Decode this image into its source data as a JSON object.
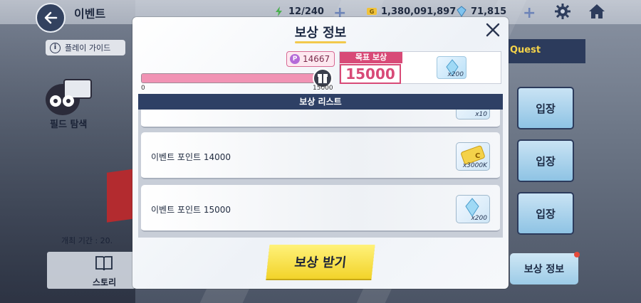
{
  "header": {
    "title": "이벤트",
    "stamina": "12/240",
    "gold": "1,380,091,897",
    "gems": "71,815"
  },
  "left_panel": {
    "guide_label": "플레이 가이드",
    "field_label": "필드 탐색",
    "period_label": "개최 기간 : 20.",
    "story_label": "스토리"
  },
  "right_panel": {
    "quest_tab": "Quest",
    "enter_labels": [
      "입장",
      "입장",
      "입장"
    ],
    "reward_info_label": "보상 정보"
  },
  "modal": {
    "title": "보상 정보",
    "progress": {
      "current": 14667,
      "max": 15000,
      "min_label": "0",
      "max_label": "15000",
      "current_label": "14667"
    },
    "target_tag": "목표 보상",
    "target_value": "15000",
    "target_reward_qty": "x200",
    "list_header": "보상 리스트",
    "rows": [
      {
        "label": "",
        "qty": "x10"
      },
      {
        "label": "이벤트 포인트 14000",
        "qty": "x3000K"
      },
      {
        "label": "이벤트 포인트 15000",
        "qty": "x200"
      }
    ],
    "claim_label": "보상 받기"
  },
  "colors": {
    "accent_pink": "#d84a77",
    "navy": "#2e4065",
    "claim_yellow": "#f2d32a"
  }
}
